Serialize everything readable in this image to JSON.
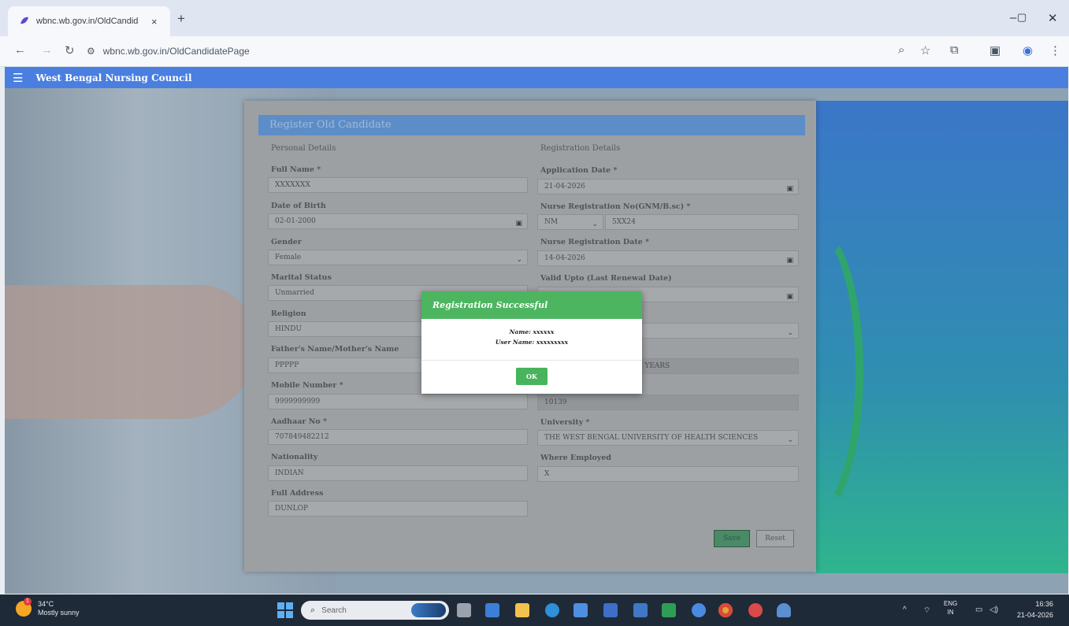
{
  "browser": {
    "tab_title": "wbnc.wb.gov.in/OldCandidatePage",
    "tab_close": "×",
    "new_tab": "+",
    "url": "wbnc.wb.gov.in/OldCandidatePage",
    "window_controls": {
      "minimize": "–",
      "restore": "▢",
      "close": "✕"
    }
  },
  "app": {
    "brand": "West Bengal Nursing Council",
    "menu_icon": "☰"
  },
  "form": {
    "title": "Register Old Candidate",
    "personal_section": "Personal Details",
    "registration_section": "Registration Details",
    "left": {
      "full_name_label": "Full Name *",
      "full_name_value": "XXXXXXX",
      "dob_label": "Date of Birth",
      "dob_value": "02-01-2000",
      "gender_label": "Gender",
      "gender_value": "Female",
      "marital_label": "Marital Status",
      "marital_value": "Unmarried",
      "religion_label": "Religion",
      "religion_value": "HINDU",
      "parent_label": "Father's Name/Mother's Name",
      "parent_value": "PPPPP",
      "mobile_label": "Mobile Number *",
      "mobile_value": "9999999999",
      "aadhaar_label": "Aadhaar No *",
      "aadhaar_value": "707849482212",
      "nationality_label": "Nationality",
      "nationality_value": "INDIAN",
      "address_label": "Full Address",
      "address_value": "DUNLOP"
    },
    "right": {
      "app_date_label": "Application Date *",
      "app_date_value": "21-04-2026",
      "nurse_reg_label": "Nurse Registration No(GNM/B.sc) *",
      "nurse_reg_prefix": "NM",
      "nurse_reg_value": "5XX24",
      "nurse_reg_date_label": "Nurse Registration Date *",
      "nurse_reg_date_value": "14-04-2026",
      "valid_upto_label": "Valid Upto (Last Renewal Date)",
      "validity_partial": "Y 0 YEARS",
      "fee_value": "10139",
      "university_label": "University *",
      "university_value": "THE WEST BENGAL UNIVERSITY OF HEALTH SCIENCES",
      "employed_label": "Where Employed",
      "employed_value": "X"
    },
    "save_label": "Save",
    "reset_label": "Reset"
  },
  "modal": {
    "title": "Registration Successful",
    "name_line": "Name: xxxxxx",
    "username_line": "User Name: xxxxxxxxx",
    "ok_label": "OK"
  },
  "taskbar": {
    "temperature": "34°C",
    "weather": "Mostly sunny",
    "weather_badge": "1",
    "search_placeholder": "Search",
    "lang_top": "ENG",
    "lang_bottom": "IN",
    "time": "16:36",
    "date": "21-04-2026"
  }
}
